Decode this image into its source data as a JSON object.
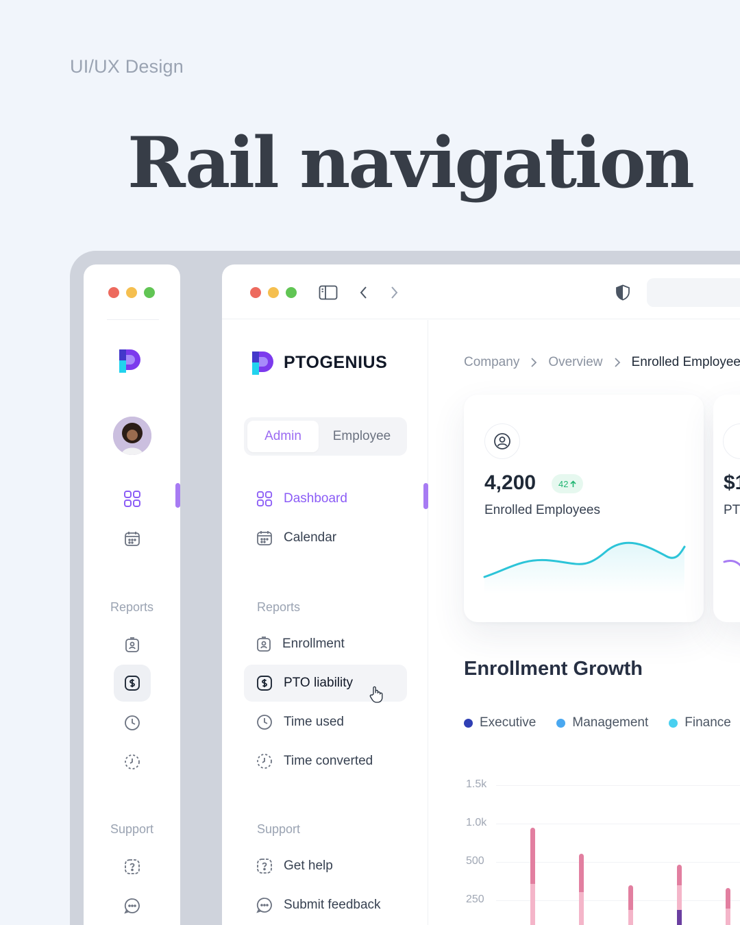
{
  "kicker": "UI/UX Design",
  "hero_title": "Rail navigation",
  "brand": {
    "name": "PTOGENIUS"
  },
  "rail": {
    "sections": [
      {
        "label": "Reports"
      },
      {
        "label": "Support"
      }
    ]
  },
  "sidebar": {
    "toggle": {
      "admin": "Admin",
      "employee": "Employee",
      "selected": "Admin"
    },
    "items": [
      {
        "label": "Dashboard",
        "icon": "grid-icon",
        "active": true
      },
      {
        "label": "Calendar",
        "icon": "calendar-icon"
      }
    ],
    "reports_label": "Reports",
    "reports": [
      {
        "label": "Enrollment",
        "icon": "id-badge-icon"
      },
      {
        "label": "PTO liability",
        "icon": "money-icon",
        "hovered": true
      },
      {
        "label": "Time used",
        "icon": "clock-icon"
      },
      {
        "label": "Time converted",
        "icon": "clock-dashed-icon"
      }
    ],
    "support_label": "Support",
    "support": [
      {
        "label": "Get help",
        "icon": "help-icon"
      },
      {
        "label": "Submit feedback",
        "icon": "chat-icon"
      }
    ]
  },
  "breadcrumb": [
    "Company",
    "Overview",
    "Enrolled Employees"
  ],
  "stat_card": {
    "value": "4,200",
    "delta": "42",
    "label": "Enrolled Employees"
  },
  "stat_card_2": {
    "value": "$1",
    "label": "PT"
  },
  "enrollment": {
    "title": "Enrollment Growth",
    "colors": {
      "Executive": "#2f3fb4",
      "Management": "#4aa8f0",
      "Finance": "#49d0f0"
    }
  },
  "chart_data": {
    "type": "bar",
    "title": "Enrollment Growth",
    "series": [
      {
        "name": "Executive"
      },
      {
        "name": "Management"
      },
      {
        "name": "Finance"
      }
    ],
    "y_ticks": [
      "1.5k",
      "1.0k",
      "500",
      "250"
    ]
  },
  "colors": {
    "accent": "#8b5cf6",
    "background": "#f1f5fb"
  }
}
